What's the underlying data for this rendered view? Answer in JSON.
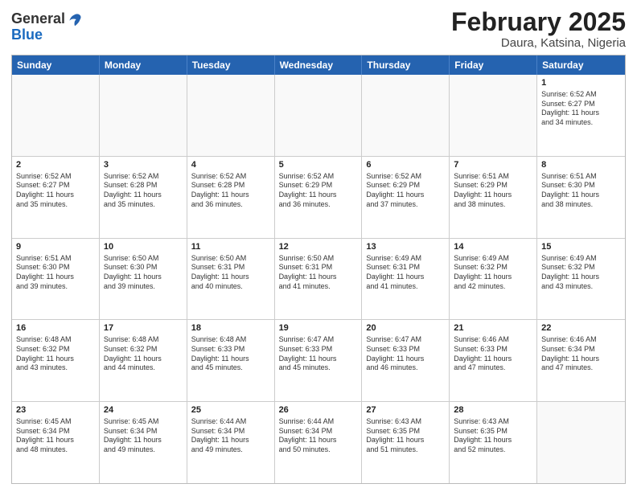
{
  "header": {
    "logo_general": "General",
    "logo_blue": "Blue",
    "month_title": "February 2025",
    "location": "Daura, Katsina, Nigeria"
  },
  "days_of_week": [
    "Sunday",
    "Monday",
    "Tuesday",
    "Wednesday",
    "Thursday",
    "Friday",
    "Saturday"
  ],
  "weeks": [
    [
      {
        "day": "",
        "info": ""
      },
      {
        "day": "",
        "info": ""
      },
      {
        "day": "",
        "info": ""
      },
      {
        "day": "",
        "info": ""
      },
      {
        "day": "",
        "info": ""
      },
      {
        "day": "",
        "info": ""
      },
      {
        "day": "1",
        "info": "Sunrise: 6:52 AM\nSunset: 6:27 PM\nDaylight: 11 hours\nand 34 minutes."
      }
    ],
    [
      {
        "day": "2",
        "info": "Sunrise: 6:52 AM\nSunset: 6:27 PM\nDaylight: 11 hours\nand 35 minutes."
      },
      {
        "day": "3",
        "info": "Sunrise: 6:52 AM\nSunset: 6:28 PM\nDaylight: 11 hours\nand 35 minutes."
      },
      {
        "day": "4",
        "info": "Sunrise: 6:52 AM\nSunset: 6:28 PM\nDaylight: 11 hours\nand 36 minutes."
      },
      {
        "day": "5",
        "info": "Sunrise: 6:52 AM\nSunset: 6:29 PM\nDaylight: 11 hours\nand 36 minutes."
      },
      {
        "day": "6",
        "info": "Sunrise: 6:52 AM\nSunset: 6:29 PM\nDaylight: 11 hours\nand 37 minutes."
      },
      {
        "day": "7",
        "info": "Sunrise: 6:51 AM\nSunset: 6:29 PM\nDaylight: 11 hours\nand 38 minutes."
      },
      {
        "day": "8",
        "info": "Sunrise: 6:51 AM\nSunset: 6:30 PM\nDaylight: 11 hours\nand 38 minutes."
      }
    ],
    [
      {
        "day": "9",
        "info": "Sunrise: 6:51 AM\nSunset: 6:30 PM\nDaylight: 11 hours\nand 39 minutes."
      },
      {
        "day": "10",
        "info": "Sunrise: 6:50 AM\nSunset: 6:30 PM\nDaylight: 11 hours\nand 39 minutes."
      },
      {
        "day": "11",
        "info": "Sunrise: 6:50 AM\nSunset: 6:31 PM\nDaylight: 11 hours\nand 40 minutes."
      },
      {
        "day": "12",
        "info": "Sunrise: 6:50 AM\nSunset: 6:31 PM\nDaylight: 11 hours\nand 41 minutes."
      },
      {
        "day": "13",
        "info": "Sunrise: 6:49 AM\nSunset: 6:31 PM\nDaylight: 11 hours\nand 41 minutes."
      },
      {
        "day": "14",
        "info": "Sunrise: 6:49 AM\nSunset: 6:32 PM\nDaylight: 11 hours\nand 42 minutes."
      },
      {
        "day": "15",
        "info": "Sunrise: 6:49 AM\nSunset: 6:32 PM\nDaylight: 11 hours\nand 43 minutes."
      }
    ],
    [
      {
        "day": "16",
        "info": "Sunrise: 6:48 AM\nSunset: 6:32 PM\nDaylight: 11 hours\nand 43 minutes."
      },
      {
        "day": "17",
        "info": "Sunrise: 6:48 AM\nSunset: 6:32 PM\nDaylight: 11 hours\nand 44 minutes."
      },
      {
        "day": "18",
        "info": "Sunrise: 6:48 AM\nSunset: 6:33 PM\nDaylight: 11 hours\nand 45 minutes."
      },
      {
        "day": "19",
        "info": "Sunrise: 6:47 AM\nSunset: 6:33 PM\nDaylight: 11 hours\nand 45 minutes."
      },
      {
        "day": "20",
        "info": "Sunrise: 6:47 AM\nSunset: 6:33 PM\nDaylight: 11 hours\nand 46 minutes."
      },
      {
        "day": "21",
        "info": "Sunrise: 6:46 AM\nSunset: 6:33 PM\nDaylight: 11 hours\nand 47 minutes."
      },
      {
        "day": "22",
        "info": "Sunrise: 6:46 AM\nSunset: 6:34 PM\nDaylight: 11 hours\nand 47 minutes."
      }
    ],
    [
      {
        "day": "23",
        "info": "Sunrise: 6:45 AM\nSunset: 6:34 PM\nDaylight: 11 hours\nand 48 minutes."
      },
      {
        "day": "24",
        "info": "Sunrise: 6:45 AM\nSunset: 6:34 PM\nDaylight: 11 hours\nand 49 minutes."
      },
      {
        "day": "25",
        "info": "Sunrise: 6:44 AM\nSunset: 6:34 PM\nDaylight: 11 hours\nand 49 minutes."
      },
      {
        "day": "26",
        "info": "Sunrise: 6:44 AM\nSunset: 6:34 PM\nDaylight: 11 hours\nand 50 minutes."
      },
      {
        "day": "27",
        "info": "Sunrise: 6:43 AM\nSunset: 6:35 PM\nDaylight: 11 hours\nand 51 minutes."
      },
      {
        "day": "28",
        "info": "Sunrise: 6:43 AM\nSunset: 6:35 PM\nDaylight: 11 hours\nand 52 minutes."
      },
      {
        "day": "",
        "info": ""
      }
    ]
  ]
}
